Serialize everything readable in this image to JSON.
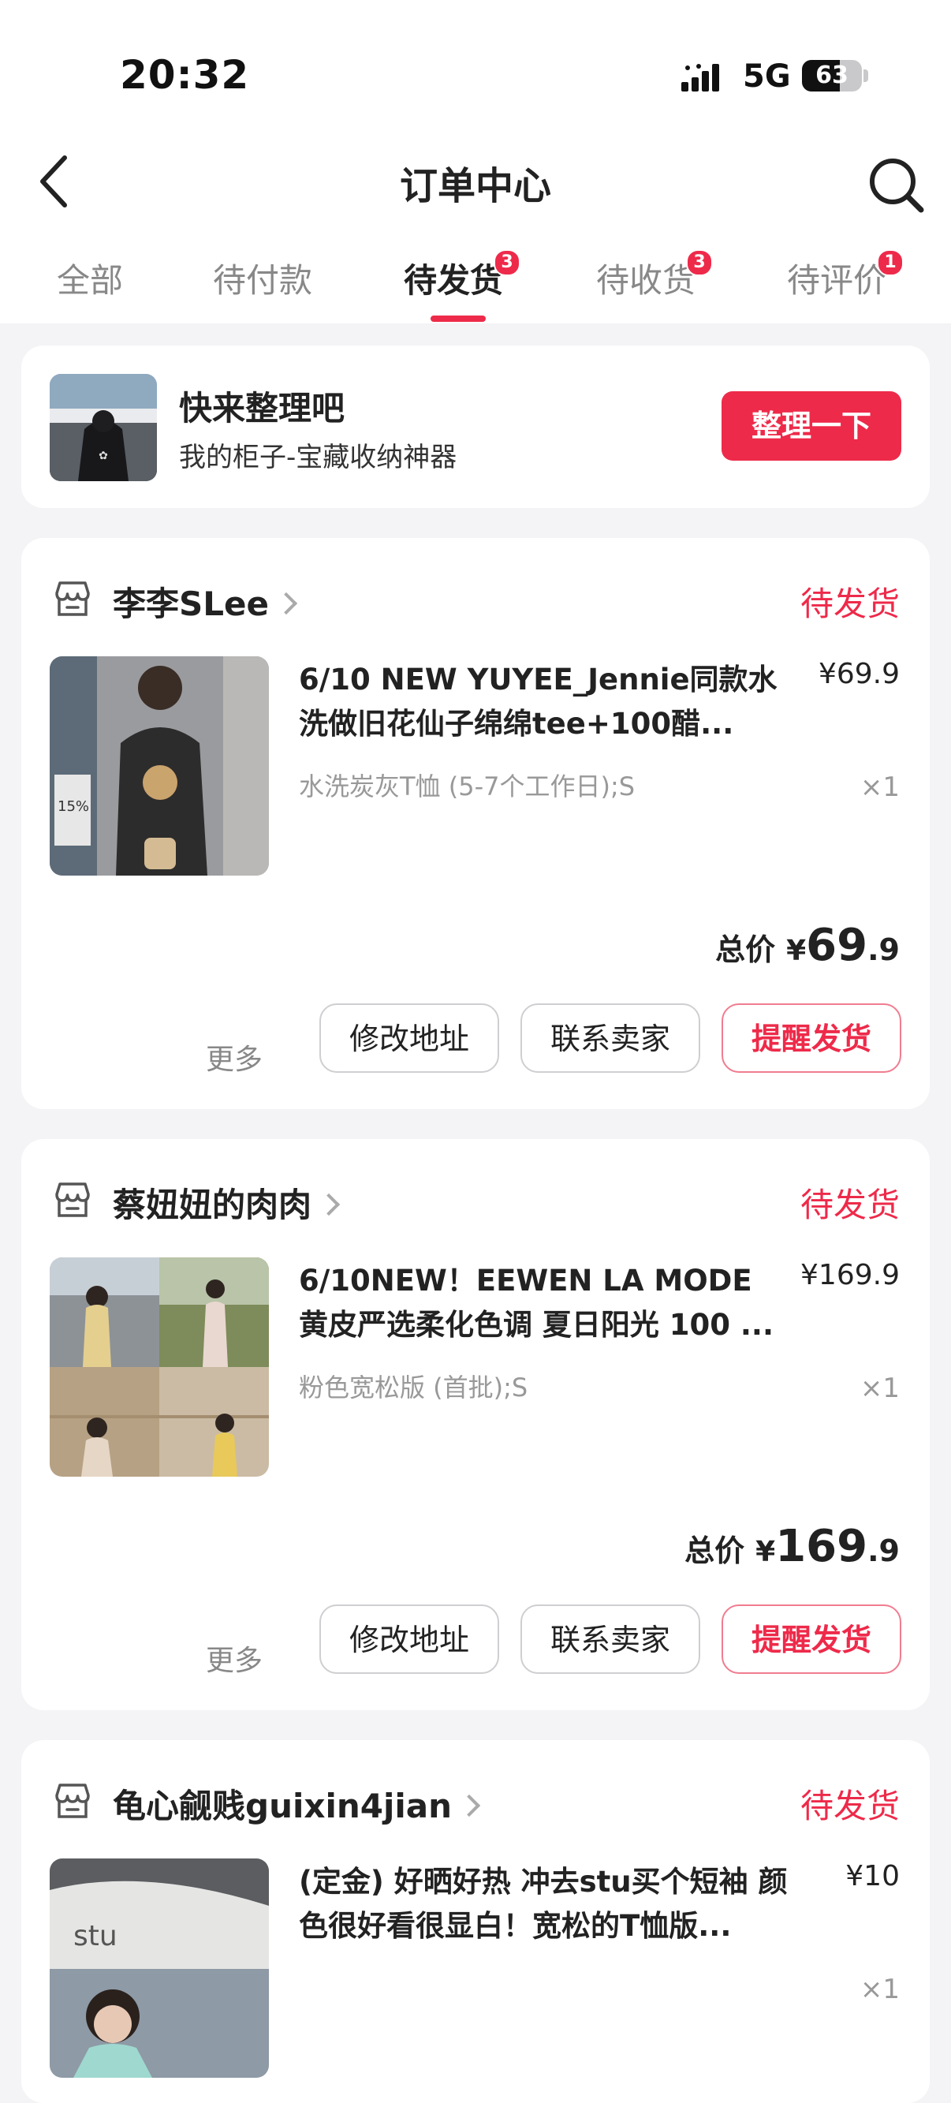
{
  "status_bar": {
    "time": "20:32",
    "network": "5G",
    "battery_level": 63,
    "battery_text": "63"
  },
  "header": {
    "title": "订单中心"
  },
  "tabs": [
    {
      "label": "全部",
      "badge": ""
    },
    {
      "label": "待付款",
      "badge": ""
    },
    {
      "label": "待发货",
      "badge": "3",
      "active": true
    },
    {
      "label": "待收货",
      "badge": "3"
    },
    {
      "label": "待评价",
      "badge": "1"
    }
  ],
  "promo": {
    "title": "快来整理吧",
    "subtitle": "我的柜子-宝藏收纳神器",
    "button": "整理一下"
  },
  "orders": [
    {
      "shop": "李李SLee",
      "status": "待发货",
      "title": "6/10 NEW YUYEE_Jennie同款水洗做旧花仙子绵绵tee+100醋...",
      "sku": "水洗炭灰T恤 (5-7个工作日);S",
      "price": "¥69.9",
      "qty": "×1",
      "total_label": "总价",
      "total_currency": "¥",
      "total_int": "69",
      "total_dec": ".9",
      "more": "更多",
      "btn_address": "修改地址",
      "btn_contact": "联系卖家",
      "btn_remind": "提醒发货"
    },
    {
      "shop": "蔡妞妞的肉肉",
      "status": "待发货",
      "title": "6/10NEW！EEWEN LA MODE 黄皮严选柔化色调 夏日阳光 100 ...",
      "sku": "粉色宽松版 (首批);S",
      "price": "¥169.9",
      "qty": "×1",
      "total_label": "总价",
      "total_currency": "¥",
      "total_int": "169",
      "total_dec": ".9",
      "more": "更多",
      "btn_address": "修改地址",
      "btn_contact": "联系卖家",
      "btn_remind": "提醒发货"
    },
    {
      "shop": "龟心觎贱guixin4jian",
      "status": "待发货",
      "title": "(定金) 好晒好热  冲去stu买个短袖 颜色很好看很显白！宽松的T恤版...",
      "sku": "",
      "price": "¥10",
      "qty": "×1"
    }
  ],
  "colors": {
    "accent": "#ee2a4a",
    "background": "#f4f4f6"
  }
}
